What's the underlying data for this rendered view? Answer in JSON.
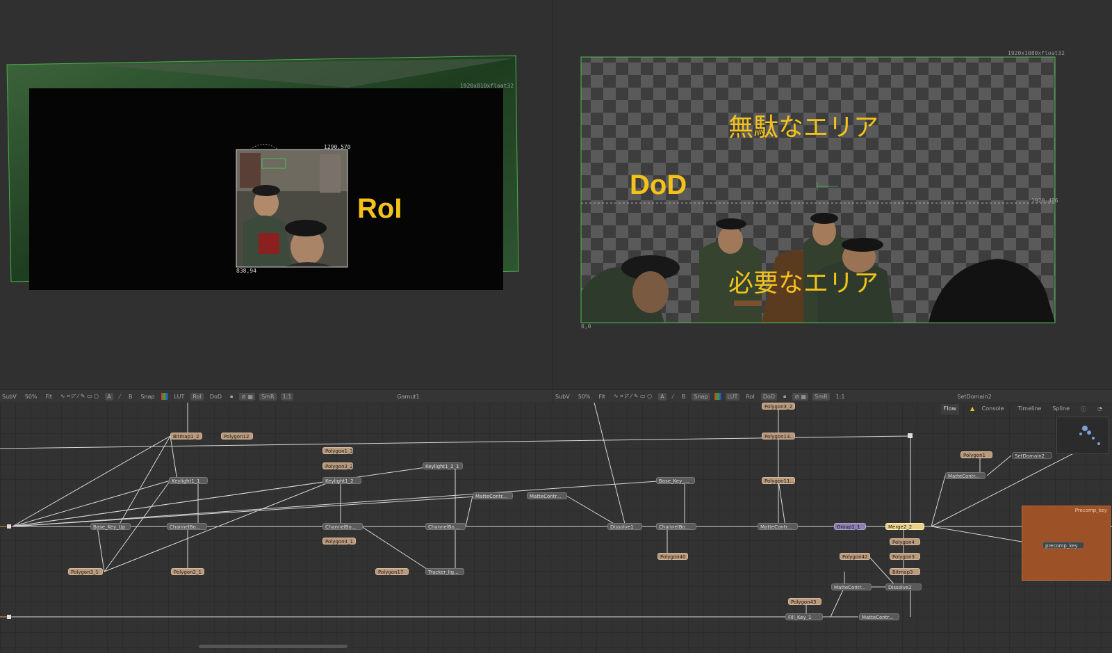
{
  "badge": "A",
  "left_viewer": {
    "res_label": "1920x810xfloat32",
    "roi_top_right": "1290,570",
    "roi_bottom_left": "838,94",
    "annotation": "RoI"
  },
  "right_viewer": {
    "res_label": "1920x1080xfloat32",
    "dod_coord": "1920,486",
    "origin": "0,0",
    "annotation_dod": "DoD",
    "annotation_wasted": "無駄なエリア",
    "annotation_needed": "必要なエリア"
  },
  "left_toolbar": {
    "subv": "SubV",
    "zoom": "50%",
    "fit": "Fit",
    "a": "A",
    "b": "B",
    "snap": "Snap",
    "lut": "LUT",
    "roi": "RoI",
    "dod": "DoD",
    "smr": "SmR",
    "ratio": "1:1",
    "node_name": "Gamut1"
  },
  "right_toolbar": {
    "subv": "SubV",
    "zoom": "50%",
    "fit": "Fit",
    "a": "A",
    "b": "B",
    "snap": "Snap",
    "lut": "LUT",
    "roi": "RoI",
    "dod": "DoD",
    "smr": "SmR",
    "ratio": "1:1",
    "node_name": "SetDomain2"
  },
  "flow_tabs": [
    "Flow",
    "Console",
    "Timeline",
    "Spline"
  ],
  "nodes": [
    {
      "label": "Bitmap1_2",
      "style": "n-tan"
    },
    {
      "label": "Polygon12",
      "style": "n-tan"
    },
    {
      "label": "Polygon1_3",
      "style": "n-tan"
    },
    {
      "label": "Polygon3_2",
      "style": "n-tan"
    },
    {
      "label": "Keylight1_2_1",
      "style": "n-gray"
    },
    {
      "label": "Keylight1_1",
      "style": "n-gray"
    },
    {
      "label": "Keylight1_2",
      "style": "n-gray"
    },
    {
      "label": "MatteContr...",
      "style": "n-gray"
    },
    {
      "label": "MatteContr...",
      "style": "n-gray"
    },
    {
      "label": "Base_Key_...",
      "style": "n-gray"
    },
    {
      "label": "Base_Key_Up",
      "style": "n-gray"
    },
    {
      "label": "ChannelBo...",
      "style": "n-gray"
    },
    {
      "label": "ChannelBo...",
      "style": "n-gray"
    },
    {
      "label": "ChannelBo...",
      "style": "n-gray"
    },
    {
      "label": "Dissolve1",
      "style": "n-gray"
    },
    {
      "label": "ChannelBo...",
      "style": "n-gray"
    },
    {
      "label": "Polygon4_1",
      "style": "n-tan"
    },
    {
      "label": "Polygon3_1",
      "style": "n-tan"
    },
    {
      "label": "Polygon2_1",
      "style": "n-tan"
    },
    {
      "label": "Polygon17",
      "style": "n-tan"
    },
    {
      "label": "Tracker_lig...",
      "style": "n-gray"
    },
    {
      "label": "Polygon40",
      "style": "n-tan"
    },
    {
      "label": "Polygon3_2",
      "style": "n-tan"
    },
    {
      "label": "Polygon13...",
      "style": "n-tan"
    },
    {
      "label": "Polygon11...",
      "style": "n-tan"
    },
    {
      "label": "MatteContr...",
      "style": "n-gray"
    },
    {
      "label": "Group1_1",
      "style": "n-purple"
    },
    {
      "label": "Merge2_2",
      "style": "n-yellow"
    },
    {
      "label": "Polygon4",
      "style": "n-tan"
    },
    {
      "label": "Polygon42",
      "style": "n-tan"
    },
    {
      "label": "Polygon3",
      "style": "n-tan"
    },
    {
      "label": "Bitmap3",
      "style": "n-tan"
    },
    {
      "label": "MatteContr...",
      "style": "n-gray"
    },
    {
      "label": "Dissolve2",
      "style": "n-gray"
    },
    {
      "label": "Polygon43",
      "style": "n-tan"
    },
    {
      "label": "Fill_Key_1",
      "style": "n-gray"
    },
    {
      "label": "MatteContr...",
      "style": "n-gray"
    },
    {
      "label": "Polygon1",
      "style": "n-tan"
    },
    {
      "label": "SetDomain2",
      "style": "n-dark"
    },
    {
      "label": "MatteContr...",
      "style": "n-gray"
    },
    {
      "label": "precomp_key",
      "style": "n-dark"
    }
  ],
  "precomp": {
    "title": "Precomp_key"
  }
}
